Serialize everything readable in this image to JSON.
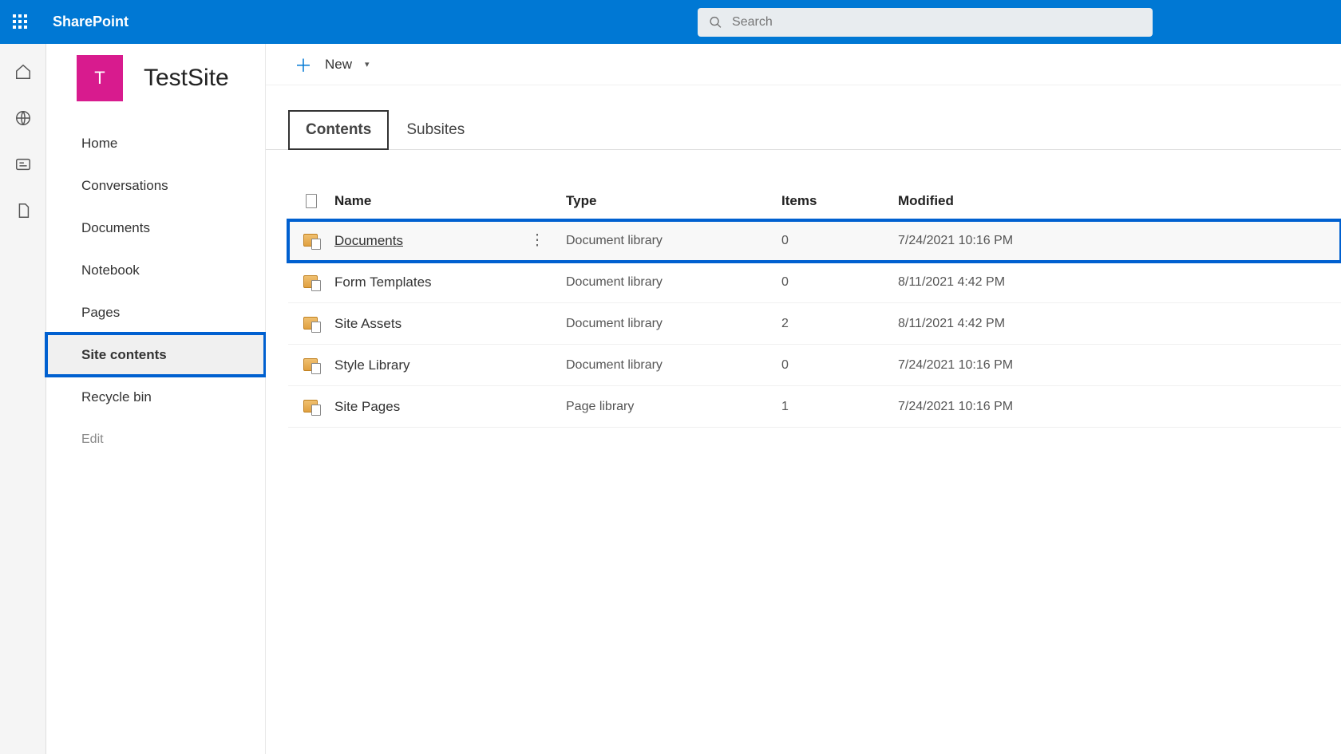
{
  "header": {
    "brand": "SharePoint",
    "search_placeholder": "Search"
  },
  "site": {
    "logo_letter": "T",
    "title": "TestSite"
  },
  "nav": {
    "items": [
      {
        "label": "Home",
        "selected": false
      },
      {
        "label": "Conversations",
        "selected": false
      },
      {
        "label": "Documents",
        "selected": false
      },
      {
        "label": "Notebook",
        "selected": false
      },
      {
        "label": "Pages",
        "selected": false
      },
      {
        "label": "Site contents",
        "selected": true
      },
      {
        "label": "Recycle bin",
        "selected": false
      }
    ],
    "edit_label": "Edit"
  },
  "command_bar": {
    "new_label": "New"
  },
  "tabs": [
    {
      "label": "Contents",
      "active": true
    },
    {
      "label": "Subsites",
      "active": false
    }
  ],
  "columns": {
    "name": "Name",
    "type": "Type",
    "items": "Items",
    "modified": "Modified"
  },
  "rows": [
    {
      "name": "Documents",
      "type": "Document library",
      "items": "0",
      "modified": "7/24/2021 10:16 PM",
      "highlighted": true
    },
    {
      "name": "Form Templates",
      "type": "Document library",
      "items": "0",
      "modified": "8/11/2021 4:42 PM",
      "highlighted": false
    },
    {
      "name": "Site Assets",
      "type": "Document library",
      "items": "2",
      "modified": "8/11/2021 4:42 PM",
      "highlighted": false
    },
    {
      "name": "Style Library",
      "type": "Document library",
      "items": "0",
      "modified": "7/24/2021 10:16 PM",
      "highlighted": false
    },
    {
      "name": "Site Pages",
      "type": "Page library",
      "items": "1",
      "modified": "7/24/2021 10:16 PM",
      "highlighted": false
    }
  ]
}
